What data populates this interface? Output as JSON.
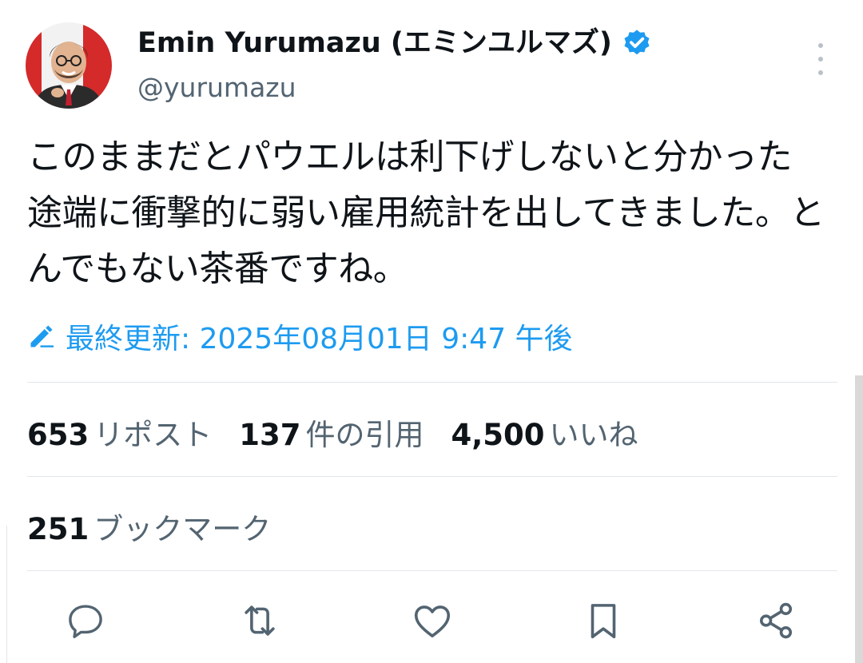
{
  "author": {
    "display_name": "Emin Yurumazu (エミンユルマズ)",
    "handle": "@yurumazu"
  },
  "tweet": {
    "text": "このままだとパウエルは利下げしないと分かった途端に衝撃的に弱い雇用統計を出してきました。とんでもない茶番ですね。",
    "edited_label": "最終更新: 2025年08月01日 9:47 午後"
  },
  "stats": {
    "reposts_count": "653",
    "reposts_label": "リポスト",
    "quotes_count": "137",
    "quotes_label": "件の引用",
    "likes_count": "4,500",
    "likes_label": "いいね",
    "bookmarks_count": "251",
    "bookmarks_label": "ブックマーク"
  },
  "icons": {
    "verified": "verified-badge-icon",
    "more": "more-vertical-icon",
    "edit": "edit-pencil-icon",
    "reply": "reply-icon",
    "repost": "repost-icon",
    "like": "like-heart-icon",
    "bookmark": "bookmark-icon",
    "share": "share-icon"
  },
  "colors": {
    "accent": "#1d9bf0",
    "secondary_text": "#536471",
    "icon_gray": "#536471"
  }
}
